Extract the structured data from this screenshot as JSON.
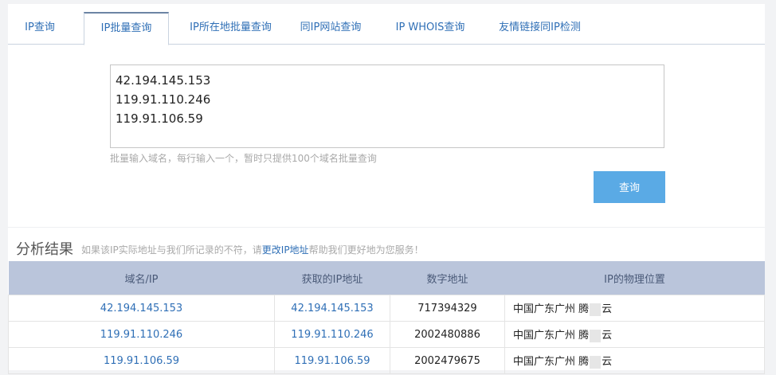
{
  "tabs": [
    {
      "label": "IP查询"
    },
    {
      "label": "IP批量查询"
    },
    {
      "label": "IP所在地批量查询"
    },
    {
      "label": "同IP网站查询"
    },
    {
      "label": "IP WHOIS查询"
    },
    {
      "label": "友情链接同IP检测"
    }
  ],
  "active_tab": "IP批量查询",
  "batch": {
    "value": "42.194.145.153\n119.91.110.246\n119.91.106.59",
    "hint": "批量输入域名，每行输入一个，暂时只提供100个域名批量查询",
    "button_label": "查询"
  },
  "result": {
    "title": "分析结果",
    "note_before": "如果该IP实际地址与我们所记录的不符，请",
    "note_link": "更改IP地址",
    "note_after": "帮助我们更好地为您服务！",
    "columns": [
      "域名/IP",
      "获取的IP地址",
      "数字地址",
      "IP的物理位置"
    ],
    "rows": [
      {
        "domain": "42.194.145.153",
        "ip": "42.194.145.153",
        "number": "717394329",
        "location_prefix": "中国广东广州 腾",
        "location_suffix": "云"
      },
      {
        "domain": "119.91.110.246",
        "ip": "119.91.110.246",
        "number": "2002480886",
        "location_prefix": "中国广东广州 腾",
        "location_suffix": "云"
      },
      {
        "domain": "119.91.106.59",
        "ip": "119.91.106.59",
        "number": "2002479675",
        "location_prefix": "中国广东广州 腾",
        "location_suffix": "云"
      }
    ]
  },
  "colors": {
    "accent": "#5aaae5",
    "link": "#2f6fb6",
    "table_header": "#bac5db"
  }
}
